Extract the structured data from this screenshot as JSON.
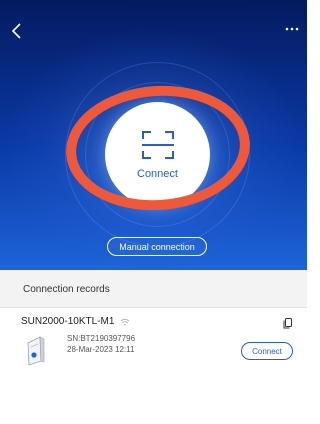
{
  "header": {
    "back_icon": "chevron-left-icon",
    "more_icon": "more-dots-icon"
  },
  "connect": {
    "icon": "scan-frame-icon",
    "label": "Connect"
  },
  "manual_connection": {
    "label": "Manual connection"
  },
  "records": {
    "title": "Connection records",
    "items": [
      {
        "name": "SUN2000-10KTL-M1",
        "sn": "SN:BT2190397796",
        "date": "28-Mar-2023 12:11",
        "connect_label": "Connect"
      }
    ]
  },
  "colors": {
    "hero_top": "#041a60",
    "hero_bottom": "#1e64d8",
    "accent": "#2a5bd6",
    "annotation": "#f0583a"
  }
}
